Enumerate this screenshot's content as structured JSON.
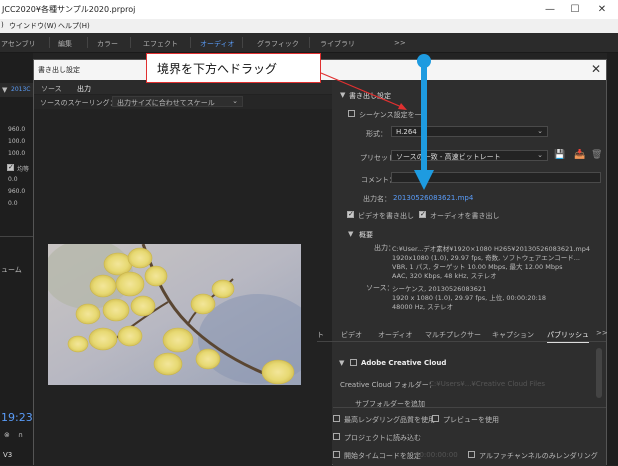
{
  "app": {
    "title": "JCC2020¥各種サンプル2020.prproj",
    "menu": [
      "ウインドウ(W)",
      "ヘルプ(H)"
    ],
    "menu_prefix": ")"
  },
  "workspaces": {
    "items": [
      "アセンブリ",
      "編集",
      "カラー",
      "エフェクト",
      "オーディオ",
      "グラフィック",
      "ライブラリ"
    ],
    "active_index": 4,
    "more": ">>"
  },
  "background_panel": {
    "sequence_label": "2013C",
    "values": [
      "960.0",
      "100.0",
      "100.0",
      "0.0",
      "960.0",
      "0.0"
    ],
    "labels": [
      "均等",
      "ューム"
    ],
    "timecode": "19:23",
    "track": "V3"
  },
  "dialog": {
    "title": "書き出し設定",
    "close": "✕",
    "left": {
      "tabs": [
        "ソース",
        "出力"
      ],
      "active_tab": 1,
      "scaling_label": "ソースのスケーリング：",
      "scaling_value": "出力サイズに合わせてスケール"
    },
    "export_settings": {
      "header": "書き出し設定",
      "match_sequence": "シーケンス設定を一",
      "format_label": "形式：",
      "format_value": "H.264",
      "preset_label": "プリセット：",
      "preset_value": "ソースの一致 - 高速ビットレート",
      "comment_label": "コメント：",
      "comment_value": "",
      "output_name_label": "出力名：",
      "output_name_value": "20130526083621.mp4",
      "export_video": "ビデオを書き出し",
      "export_audio": "オーディオを書き出し"
    },
    "summary": {
      "header": "概要",
      "output_label": "出力：",
      "output_lines": [
        "C:¥User...デオ素材¥1920×1080 H265¥20130526083621.mp4",
        "1920x1080 (1.0), 29.97 fps, 奇数, ソフトウェアエンコード...",
        "VBR, 1 パス, ターゲット 10.00 Mbps, 最大 12.00 Mbps",
        "AAC, 320 Kbps, 48 kHz, ステレオ"
      ],
      "source_label": "ソース：",
      "source_lines": [
        "シーケンス, 20130526083621",
        "1920 x 1080 (1.0), 29.97 fps, 上位, 00:00:20:18",
        "48000 Hz, ステレオ"
      ]
    },
    "tabs": {
      "items": [
        "エフェクト",
        "ビデオ",
        "オーディオ",
        "マルチプレクサー",
        "キャプション",
        "パブリッシュ"
      ],
      "active_index": 5,
      "more": ">>"
    },
    "publish": {
      "section": "Adobe Creative Cloud",
      "folder_label": "Creative Cloud フォルダー：",
      "folder_value": "C:¥Users¥...¥Creative Cloud Files",
      "subfolder_label": "サブフォルダーを追加"
    },
    "bottom": {
      "max_render": "最高レンダリング品質を使用",
      "use_preview": "プレビューを使用",
      "import_project": "プロジェクトに読み込む",
      "set_start_tc": "開始タイムコードを設定",
      "start_tc_value": "00:00:00:00",
      "alpha_only": "アルファチャンネルのみレンダリング"
    }
  },
  "annotation": {
    "text": "境界を下方へドラッグ",
    "arrow_color": "#e03030",
    "drag_color": "#1e9be0"
  },
  "colors": {
    "accent": "#5a9cf8"
  }
}
